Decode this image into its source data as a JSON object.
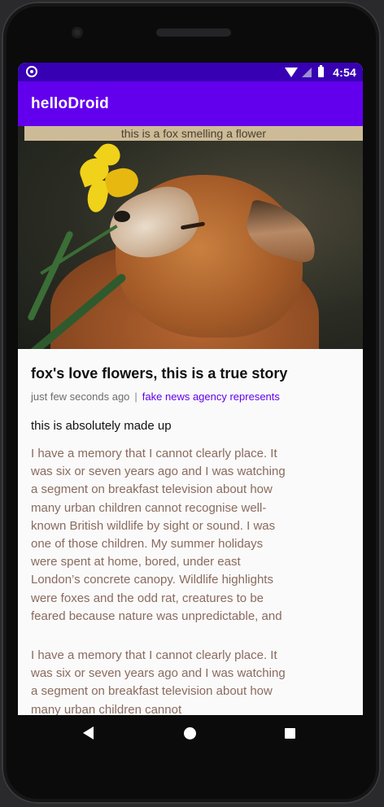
{
  "status_bar": {
    "time": "4:54",
    "icons": [
      "notification-dot-icon",
      "wifi-icon",
      "signal-icon",
      "battery-icon"
    ]
  },
  "app_bar": {
    "title": "helloDroid"
  },
  "hero": {
    "caption": "this is a fox smelling a flower"
  },
  "article": {
    "headline": "fox's love flowers, this is a true story",
    "timestamp": "just few seconds ago",
    "separator": "|",
    "source": "fake news agency represents",
    "subheading": "this is absolutely made up",
    "paragraph_1": "I have a memory that I cannot clearly place. It was six or seven years ago and I was watching a segment on breakfast television about how many urban children cannot recognise well-known British wildlife by sight or sound. I was one of those children. My summer holidays were spent at home, bored, under east London’s concrete canopy. Wildlife highlights were foxes and the odd rat, creatures to be feared because nature was unpredictable, and sometimes even",
    "paragraph_2": "I have a memory that I cannot clearly place. It was six or seven years ago and I was watching a segment on breakfast television about how many urban children cannot"
  },
  "colors": {
    "status_bar": "#3700b3",
    "app_bar": "#6200ee",
    "accent_link": "#6200ee",
    "body_text": "#8a6b5e"
  },
  "nav_bar": {
    "buttons": [
      "back-icon",
      "home-icon",
      "recents-icon"
    ]
  }
}
